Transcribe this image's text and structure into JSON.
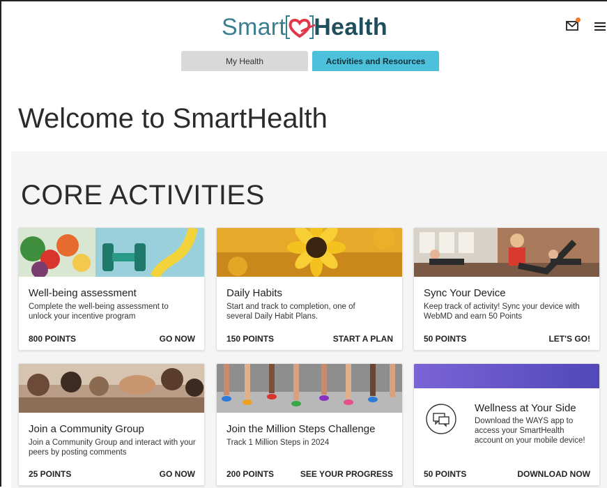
{
  "header": {
    "logo_smart": "Smart",
    "logo_health": "Health",
    "brand_colors": {
      "teal": "#3a7f8f",
      "heart": "#e0384a",
      "tab_active": "#4dc0db"
    }
  },
  "tabs": [
    {
      "label": "My Health",
      "active": false
    },
    {
      "label": "Activities and Resources",
      "active": true
    }
  ],
  "welcome": "Welcome to SmartHealth",
  "core": {
    "title": "CORE ACTIVITIES",
    "cards": [
      {
        "title": "Well-being assessment",
        "desc": "Complete the well-being assessment to unlock your incentive program",
        "points": "800 POINTS",
        "cta": "GO NOW"
      },
      {
        "title": "Daily Habits",
        "desc": "Start and track to completion, one of several Daily Habit Plans.",
        "points": "150 POINTS",
        "cta": "START A PLAN"
      },
      {
        "title": "Sync Your Device",
        "desc": "Keep track of activity! Sync your device with WebMD and earn 50 Points",
        "points": "50 POINTS",
        "cta": "LET'S GO!"
      },
      {
        "title": "Join a Community Group",
        "desc": "Join a Community Group and interact with your peers by posting comments",
        "points": "25 POINTS",
        "cta": "GO NOW"
      },
      {
        "title": "Join the Million Steps Challenge",
        "desc": "Track 1 Million Steps in 2024",
        "points": "200 POINTS",
        "cta": "SEE YOUR PROGRESS"
      },
      {
        "title": "Wellness at Your Side",
        "desc": "Download the WAYS app to access your SmartHealth account on your mobile device!",
        "points": "50 POINTS",
        "cta": "DOWNLOAD NOW"
      }
    ]
  }
}
